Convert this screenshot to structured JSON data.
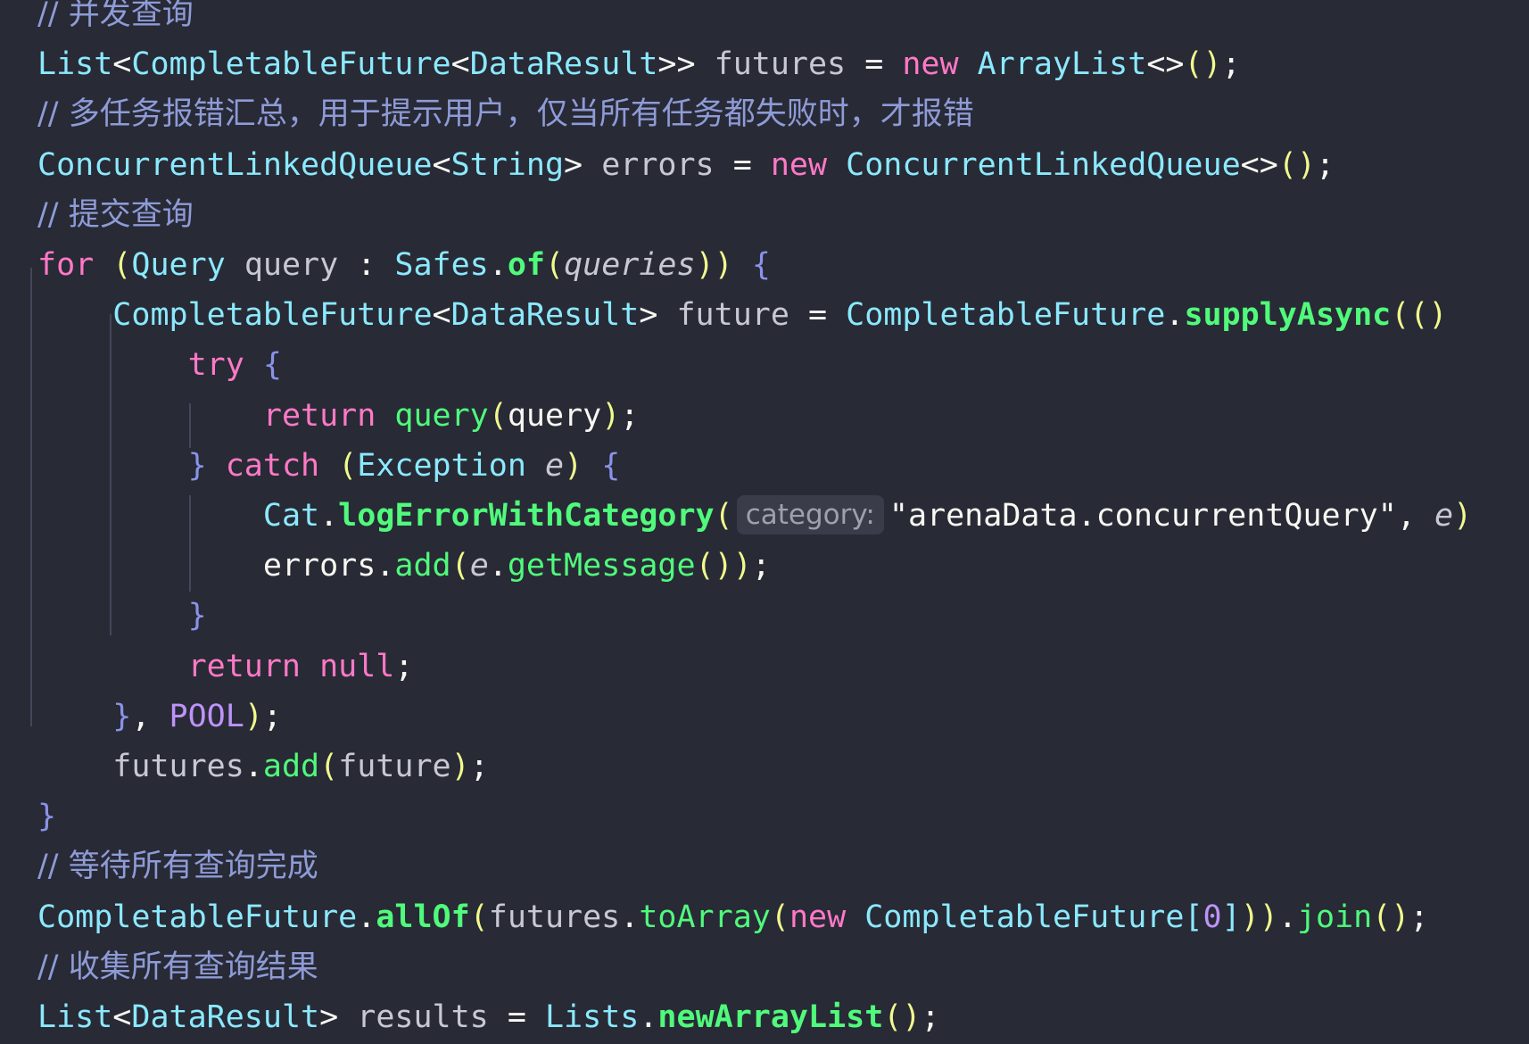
{
  "code": {
    "language": "java",
    "lines": [
      [
        {
          "t": "// 并发查询",
          "c": "comment"
        }
      ],
      [
        {
          "t": "List",
          "c": "type"
        },
        {
          "t": "<",
          "c": "punct"
        },
        {
          "t": "CompletableFuture",
          "c": "type"
        },
        {
          "t": "<",
          "c": "punct"
        },
        {
          "t": "DataResult",
          "c": "type"
        },
        {
          "t": ">> ",
          "c": "punct"
        },
        {
          "t": "futures",
          "c": "var"
        },
        {
          "t": " = ",
          "c": "punct"
        },
        {
          "t": "new",
          "c": "keyword"
        },
        {
          "t": " ",
          "c": "punct"
        },
        {
          "t": "ArrayList",
          "c": "type"
        },
        {
          "t": "<>",
          "c": "punct"
        },
        {
          "t": "()",
          "c": "paren"
        },
        {
          "t": ";",
          "c": "punct"
        }
      ],
      [
        {
          "t": "// 多任务报错汇总，用于提示用户，仅当所有任务都失败时，才报错",
          "c": "comment"
        }
      ],
      [
        {
          "t": "ConcurrentLinkedQueue",
          "c": "type"
        },
        {
          "t": "<",
          "c": "punct"
        },
        {
          "t": "String",
          "c": "type"
        },
        {
          "t": "> ",
          "c": "punct"
        },
        {
          "t": "errors",
          "c": "var"
        },
        {
          "t": " = ",
          "c": "punct"
        },
        {
          "t": "new",
          "c": "keyword"
        },
        {
          "t": " ",
          "c": "punct"
        },
        {
          "t": "ConcurrentLinkedQueue",
          "c": "type"
        },
        {
          "t": "<>",
          "c": "punct"
        },
        {
          "t": "()",
          "c": "paren"
        },
        {
          "t": ";",
          "c": "punct"
        }
      ],
      [
        {
          "t": "// 提交查询",
          "c": "comment"
        }
      ],
      [
        {
          "t": "for",
          "c": "keyword"
        },
        {
          "t": " ",
          "c": "punct"
        },
        {
          "t": "(",
          "c": "paren"
        },
        {
          "t": "Query",
          "c": "type"
        },
        {
          "t": " ",
          "c": "punct"
        },
        {
          "t": "query",
          "c": "var"
        },
        {
          "t": " : ",
          "c": "punct"
        },
        {
          "t": "Safes",
          "c": "type"
        },
        {
          "t": ".",
          "c": "punct"
        },
        {
          "t": "of",
          "c": "method-bold"
        },
        {
          "t": "(",
          "c": "paren"
        },
        {
          "t": "queries",
          "c": "italic"
        },
        {
          "t": "))",
          "c": "paren"
        },
        {
          "t": " ",
          "c": "punct"
        },
        {
          "t": "{",
          "c": "brace"
        }
      ],
      [
        {
          "t": "    ",
          "c": "punct"
        },
        {
          "t": "CompletableFuture",
          "c": "type"
        },
        {
          "t": "<",
          "c": "punct"
        },
        {
          "t": "DataResult",
          "c": "type"
        },
        {
          "t": "> ",
          "c": "punct"
        },
        {
          "t": "future",
          "c": "var"
        },
        {
          "t": " = ",
          "c": "punct"
        },
        {
          "t": "CompletableFuture",
          "c": "type"
        },
        {
          "t": ".",
          "c": "punct"
        },
        {
          "t": "supplyAsync",
          "c": "method-bold"
        },
        {
          "t": "(()",
          "c": "paren"
        }
      ],
      [
        {
          "t": "        ",
          "c": "punct"
        },
        {
          "t": "try",
          "c": "keyword"
        },
        {
          "t": " ",
          "c": "punct"
        },
        {
          "t": "{",
          "c": "brace"
        }
      ],
      [
        {
          "t": "            ",
          "c": "punct"
        },
        {
          "t": "return",
          "c": "keyword"
        },
        {
          "t": " ",
          "c": "punct"
        },
        {
          "t": "query",
          "c": "method"
        },
        {
          "t": "(",
          "c": "paren"
        },
        {
          "t": "query",
          "c": "plain"
        },
        {
          "t": ")",
          "c": "paren"
        },
        {
          "t": ";",
          "c": "punct"
        }
      ],
      [
        {
          "t": "        ",
          "c": "punct"
        },
        {
          "t": "}",
          "c": "brace"
        },
        {
          "t": " ",
          "c": "punct"
        },
        {
          "t": "catch",
          "c": "keyword"
        },
        {
          "t": " ",
          "c": "punct"
        },
        {
          "t": "(",
          "c": "paren"
        },
        {
          "t": "Exception",
          "c": "type"
        },
        {
          "t": " ",
          "c": "punct"
        },
        {
          "t": "e",
          "c": "italic"
        },
        {
          "t": ")",
          "c": "paren"
        },
        {
          "t": " ",
          "c": "punct"
        },
        {
          "t": "{",
          "c": "brace"
        }
      ],
      [
        {
          "t": "            ",
          "c": "punct"
        },
        {
          "t": "Cat",
          "c": "type"
        },
        {
          "t": ".",
          "c": "punct"
        },
        {
          "t": "logErrorWithCategory",
          "c": "method-bold"
        },
        {
          "t": "(",
          "c": "paren"
        },
        {
          "t": "category:",
          "c": "hint"
        },
        {
          "t": "\"arenaData.concurrentQuery\"",
          "c": "string-plain"
        },
        {
          "t": ", ",
          "c": "punct"
        },
        {
          "t": "e",
          "c": "italic"
        },
        {
          "t": ")",
          "c": "paren"
        }
      ],
      [
        {
          "t": "            ",
          "c": "punct"
        },
        {
          "t": "errors",
          "c": "plain"
        },
        {
          "t": ".",
          "c": "punct"
        },
        {
          "t": "add",
          "c": "method"
        },
        {
          "t": "(",
          "c": "paren"
        },
        {
          "t": "e",
          "c": "italic"
        },
        {
          "t": ".",
          "c": "punct"
        },
        {
          "t": "getMessage",
          "c": "method"
        },
        {
          "t": "())",
          "c": "paren"
        },
        {
          "t": ";",
          "c": "punct"
        }
      ],
      [
        {
          "t": "        ",
          "c": "punct"
        },
        {
          "t": "}",
          "c": "brace"
        }
      ],
      [
        {
          "t": "        ",
          "c": "punct"
        },
        {
          "t": "return",
          "c": "keyword"
        },
        {
          "t": " ",
          "c": "punct"
        },
        {
          "t": "null",
          "c": "keyword"
        },
        {
          "t": ";",
          "c": "punct"
        }
      ],
      [
        {
          "t": "    ",
          "c": "punct"
        },
        {
          "t": "}",
          "c": "brace"
        },
        {
          "t": ", ",
          "c": "punct"
        },
        {
          "t": "POOL",
          "c": "const"
        },
        {
          "t": ")",
          "c": "paren"
        },
        {
          "t": ";",
          "c": "punct"
        }
      ],
      [
        {
          "t": "    ",
          "c": "punct"
        },
        {
          "t": "futures",
          "c": "var"
        },
        {
          "t": ".",
          "c": "punct"
        },
        {
          "t": "add",
          "c": "method"
        },
        {
          "t": "(",
          "c": "paren"
        },
        {
          "t": "future",
          "c": "var"
        },
        {
          "t": ")",
          "c": "paren"
        },
        {
          "t": ";",
          "c": "punct"
        }
      ],
      [
        {
          "t": "}",
          "c": "brace"
        }
      ],
      [
        {
          "t": "// 等待所有查询完成",
          "c": "comment"
        }
      ],
      [
        {
          "t": "CompletableFuture",
          "c": "type"
        },
        {
          "t": ".",
          "c": "punct"
        },
        {
          "t": "allOf",
          "c": "method-bold"
        },
        {
          "t": "(",
          "c": "paren"
        },
        {
          "t": "futures",
          "c": "var"
        },
        {
          "t": ".",
          "c": "punct"
        },
        {
          "t": "toArray",
          "c": "method"
        },
        {
          "t": "(",
          "c": "paren"
        },
        {
          "t": "new",
          "c": "keyword"
        },
        {
          "t": " ",
          "c": "punct"
        },
        {
          "t": "CompletableFuture",
          "c": "type"
        },
        {
          "t": "[",
          "c": "type"
        },
        {
          "t": "0",
          "c": "number"
        },
        {
          "t": "]",
          "c": "type"
        },
        {
          "t": "))",
          "c": "paren"
        },
        {
          "t": ".",
          "c": "punct"
        },
        {
          "t": "join",
          "c": "method"
        },
        {
          "t": "()",
          "c": "paren"
        },
        {
          "t": ";",
          "c": "punct"
        }
      ],
      [
        {
          "t": "// 收集所有查询结果",
          "c": "comment"
        }
      ],
      [
        {
          "t": "List",
          "c": "type"
        },
        {
          "t": "<",
          "c": "punct"
        },
        {
          "t": "DataResult",
          "c": "type"
        },
        {
          "t": "> ",
          "c": "punct"
        },
        {
          "t": "results",
          "c": "var"
        },
        {
          "t": " = ",
          "c": "punct"
        },
        {
          "t": "Lists",
          "c": "type"
        },
        {
          "t": ".",
          "c": "punct"
        },
        {
          "t": "newArrayList",
          "c": "method-bold"
        },
        {
          "t": "()",
          "c": "paren"
        },
        {
          "t": ";",
          "c": "punct"
        }
      ]
    ]
  },
  "colors": {
    "background": "#282a36",
    "comment": "#8e9bd6",
    "type": "#8be9fd",
    "keyword": "#ff79c6",
    "method": "#50fa7b",
    "paren": "#f1fa8c",
    "brace": "#8a93e8",
    "constant": "#bd93f9"
  }
}
